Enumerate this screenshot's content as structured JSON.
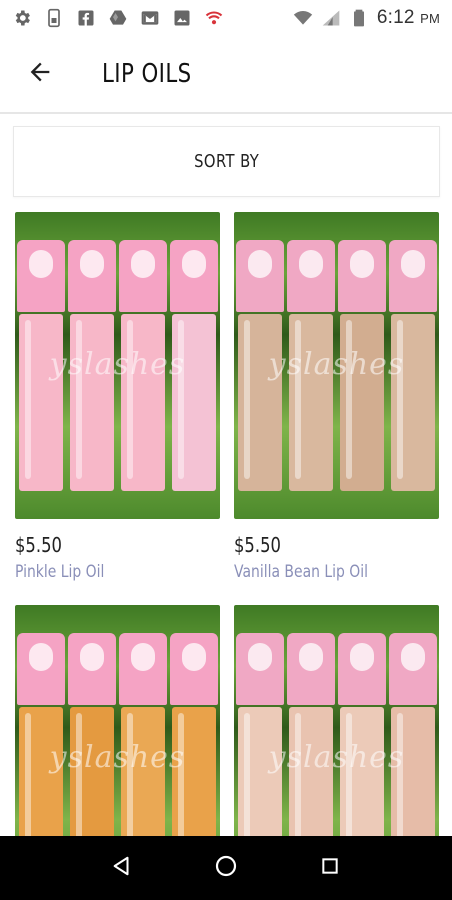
{
  "status_bar": {
    "time": "6:12",
    "ampm": "PM",
    "icons": [
      "gear-icon",
      "sim-icon",
      "facebook-icon",
      "drive-icon",
      "gmail-icon",
      "photos-icon",
      "wifi-alert-icon"
    ],
    "right_icons": [
      "wifi-icon",
      "signal-icon",
      "battery-icon"
    ]
  },
  "app_bar": {
    "back_icon": "arrow-left-icon",
    "title": "LIP OILS"
  },
  "sort": {
    "label": "SORT BY"
  },
  "products": [
    {
      "price": "$5.50",
      "name": "Pinkle Lip Oil",
      "watermark": "yslashes",
      "tint": "#f4b0c4"
    },
    {
      "price": "$5.50",
      "name": "Vanilla Bean Lip Oil",
      "watermark": "yslashes",
      "tint": "#d9b79c"
    },
    {
      "price": "",
      "name": "",
      "watermark": "yslashes",
      "tint": "#e9a24a"
    },
    {
      "price": "",
      "name": "",
      "watermark": "yslashes",
      "tint": "#e9c3b0"
    }
  ],
  "nav_bar": {
    "icons": [
      "back-triangle-icon",
      "home-circle-icon",
      "recents-square-icon"
    ]
  },
  "colors": {
    "price_text": "#222222",
    "name_text": "#8a8fb8",
    "cap_pink": "#f29ac0",
    "nav_bg": "#000000"
  }
}
